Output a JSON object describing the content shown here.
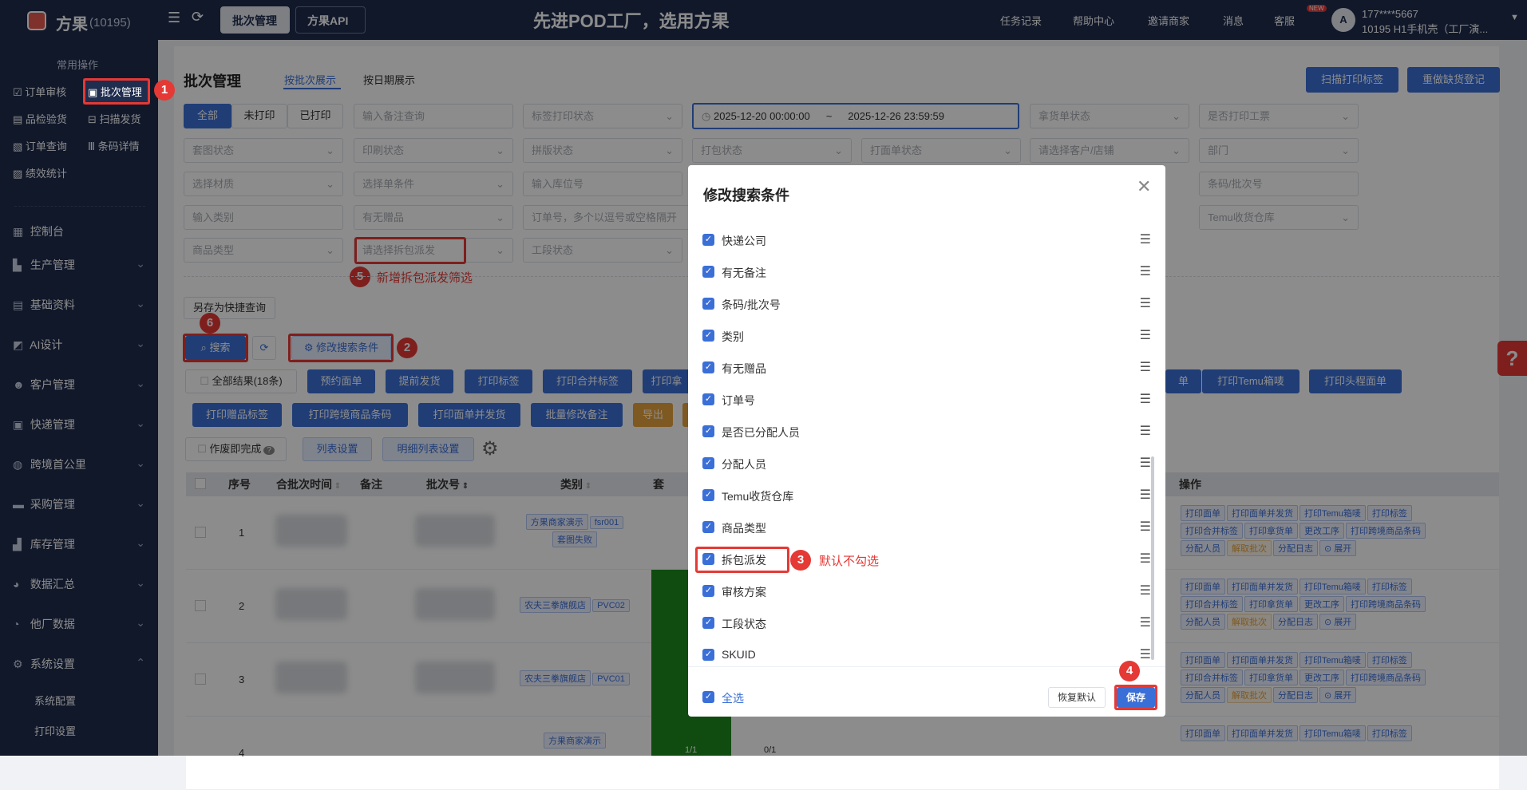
{
  "top": {
    "logo": "方果",
    "count": "(10195)",
    "tabs": [
      "批次管理",
      "方果API"
    ],
    "slogan": "先进POD工厂，选用方果",
    "nav": [
      "任务记录",
      "帮助中心",
      "邀请商家",
      "消息",
      "客服"
    ],
    "new_badge": "NEW",
    "user_phone": "177****5667",
    "user_org": "10195 H1手机壳（工厂演..."
  },
  "sidebar": {
    "section": "常用操作",
    "quick": [
      "订单审核",
      "批次管理",
      "品检验货",
      "扫描发货",
      "订单查询",
      "条码详情",
      "绩效统计"
    ],
    "menus": [
      "控制台",
      "生产管理",
      "基础资料",
      "AI设计",
      "客户管理",
      "快递管理",
      "跨境首公里",
      "采购管理",
      "库存管理",
      "数据汇总",
      "他厂数据",
      "系统设置"
    ],
    "submenus": [
      "系统配置",
      "打印设置"
    ]
  },
  "page": {
    "title": "批次管理",
    "view_tabs": [
      "按批次展示",
      "按日期展示"
    ],
    "right_buttons": [
      "扫描打印标签",
      "重做缺货登记"
    ],
    "print_filter": [
      "全部",
      "未打印",
      "已打印"
    ],
    "date_start": "2025-12-20 00:00:00",
    "date_sep": "~",
    "date_end": "2025-12-26 23:59:59",
    "filters_row1": [
      "输入备注查询",
      "标签打印状态",
      "拿货单状态",
      "是否打印工票"
    ],
    "filters_row2": [
      "套图状态",
      "印刷状态",
      "拼版状态",
      "打包状态",
      "打面单状态",
      "请选择客户/店铺",
      "部门"
    ],
    "filters_row3": [
      "选择材质",
      "选择单条件",
      "输入库位号",
      "条码/批次号"
    ],
    "filters_row4": [
      "输入类别",
      "有无赠品",
      "订单号，多个以逗号或空格隔开",
      "Temu收货仓库"
    ],
    "filters_row5": [
      "商品类型",
      "请选择拆包派发",
      "工段状态"
    ],
    "save_quick": "另存为快捷查询",
    "search": "搜索",
    "modify": "修改搜索条件",
    "action_row1": [
      "全部结果(18条)",
      "预约面单",
      "提前发货",
      "打印标签",
      "打印合并标签",
      "打印拿",
      "单",
      "打印Temu箱唛",
      "打印头程面单"
    ],
    "action_row2": [
      "打印赠品标签",
      "打印跨境商品条码",
      "打印面单并发货",
      "批量修改备注",
      "导出"
    ],
    "action_row3": [
      "作废即完成",
      "列表设置",
      "明细列表设置"
    ],
    "table_headers": [
      "序号",
      "合批次时间",
      "备注",
      "批次号",
      "类别",
      "套",
      "操作"
    ],
    "rows": [
      {
        "no": "1",
        "tags": [
          "方果商家演示",
          "fsr001",
          "套图失败"
        ]
      },
      {
        "no": "2",
        "tags": [
          "农夫三拳旗舰店",
          "PVC02"
        ]
      },
      {
        "no": "3",
        "tags": [
          "农夫三拳旗舰店",
          "PVC01"
        ]
      },
      {
        "no": "4",
        "tags": [
          "方果商家演示"
        ],
        "extra": "1/1",
        "extra2": "0/1"
      }
    ],
    "op_tags": [
      [
        "打印面单",
        "打印面单并发货",
        "打印Temu箱唛",
        "打印标签"
      ],
      [
        "打印合并标签",
        "打印拿货单",
        "更改工序",
        "打印跨境商品条码"
      ],
      [
        "分配人员",
        "解取批次",
        "分配日志",
        "⊙ 展开"
      ]
    ]
  },
  "modal": {
    "title": "修改搜索条件",
    "items": [
      "快递公司",
      "有无备注",
      "条码/批次号",
      "类别",
      "有无赠品",
      "订单号",
      "是否已分配人员",
      "分配人员",
      "Temu收货仓库",
      "商品类型",
      "拆包派发",
      "审核方案",
      "工段状态",
      "SKUID"
    ],
    "select_all": "全选",
    "reset": "恢复默认",
    "save": "保存"
  },
  "annotations": {
    "n1": "1",
    "n2": "2",
    "n3": "3",
    "n4": "4",
    "n5": "5",
    "n6": "6",
    "note3": "默认不勾选",
    "note5": "新增拆包派发筛选"
  },
  "colors": {
    "navy": "#1f2d4e",
    "primary": "#3b6fd8",
    "red": "#e53935",
    "orange": "#e6a23c"
  }
}
